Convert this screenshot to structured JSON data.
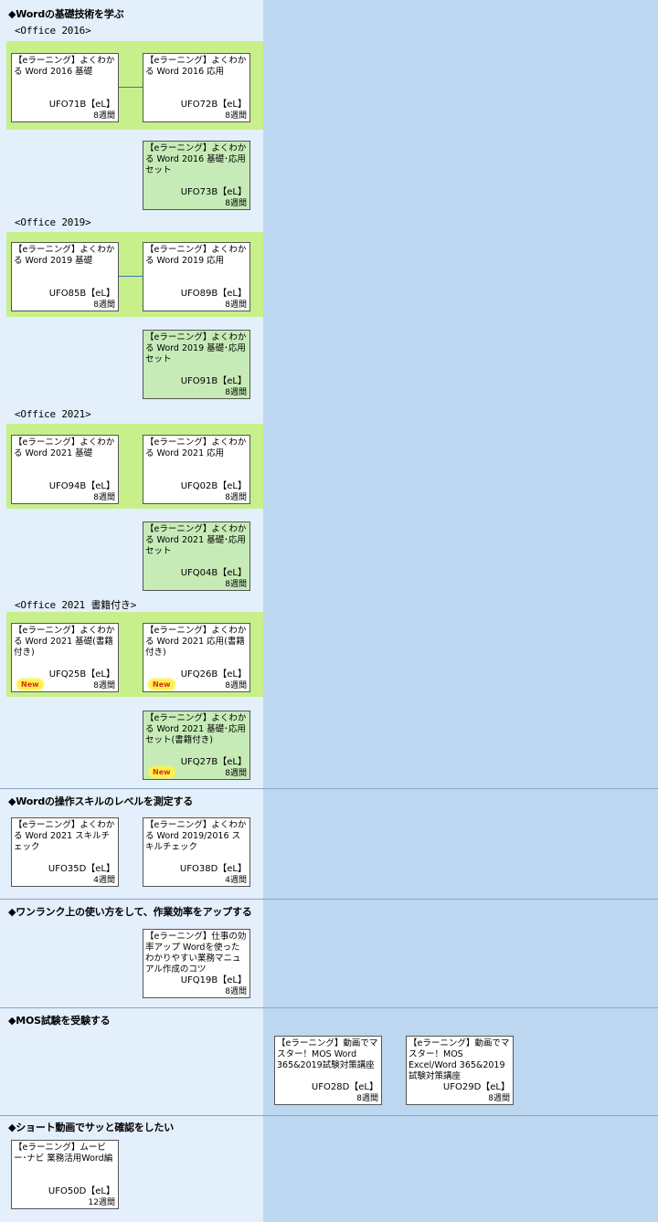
{
  "sections": [
    {
      "title": "◆Wordの基礎技術を学ぶ"
    },
    {
      "title": "◆Wordの操作スキルのレベルを測定する"
    },
    {
      "title": "◆ワンランク上の使い方をして、作業効率をアップする"
    },
    {
      "title": "◆MOS試験を受験する"
    },
    {
      "title": "◆ショート動画でサッと確認をしたい"
    }
  ],
  "subheadings": [
    "<Office 2016>",
    "<Office 2019>",
    "<Office 2021>",
    "<Office 2021 書籍付き>"
  ],
  "new_label": "New",
  "courses": [
    {
      "name": "【eラーニング】よくわかる Word 2016 基礎",
      "code": "UFO71B【eL】",
      "duration": "8週間"
    },
    {
      "name": "【eラーニング】よくわかる Word 2016 応用",
      "code": "UFO72B【eL】",
      "duration": "8週間"
    },
    {
      "name": "【eラーニング】よくわかる Word 2016 基礎･応用セット",
      "code": "UFO73B【eL】",
      "duration": "8週間"
    },
    {
      "name": "【eラーニング】よくわかる Word 2019 基礎",
      "code": "UFO85B【eL】",
      "duration": "8週間"
    },
    {
      "name": "【eラーニング】よくわかる Word 2019 応用",
      "code": "UFO89B【eL】",
      "duration": "8週間"
    },
    {
      "name": "【eラーニング】よくわかる Word 2019 基礎･応用セット",
      "code": "UFO91B【eL】",
      "duration": "8週間"
    },
    {
      "name": "【eラーニング】よくわかる Word 2021 基礎",
      "code": "UFO94B【eL】",
      "duration": "8週間"
    },
    {
      "name": "【eラーニング】よくわかる Word 2021 応用",
      "code": "UFQ02B【eL】",
      "duration": "8週間"
    },
    {
      "name": "【eラーニング】よくわかる Word 2021 基礎･応用セット",
      "code": "UFQ04B【eL】",
      "duration": "8週間"
    },
    {
      "name": "【eラーニング】よくわかる Word 2021 基礎(書籍付き)",
      "code": "UFQ25B【eL】",
      "duration": "8週間"
    },
    {
      "name": "【eラーニング】よくわかる Word 2021 応用(書籍付き)",
      "code": "UFQ26B【eL】",
      "duration": "8週間"
    },
    {
      "name": "【eラーニング】よくわかる Word 2021 基礎･応用セット(書籍付き)",
      "code": "UFQ27B【eL】",
      "duration": "8週間"
    },
    {
      "name": "【eラーニング】よくわかる Word 2021 スキルチェック",
      "code": "UFO35D【eL】",
      "duration": "4週間"
    },
    {
      "name": "【eラーニング】よくわかる Word 2019/2016 スキルチェック",
      "code": "UFO38D【eL】",
      "duration": "4週間"
    },
    {
      "name": "【eラーニング】仕事の効率アップ Wordを使ったわかりやすい業務マニュアル作成のコツ",
      "code": "UFQ19B【eL】",
      "duration": "8週間"
    },
    {
      "name": "【eラーニング】動画でマスター！MOS Word 365&2019試験対策講座",
      "code": "UFO28D【eL】",
      "duration": "8週間"
    },
    {
      "name": "【eラーニング】動画でマスター！MOS Excel/Word 365&2019 試験対策講座",
      "code": "UFO29D【eL】",
      "duration": "8週間"
    },
    {
      "name": "【eラーニング】ムービー･ナビ 業務活用Word編",
      "code": "UFO50D【eL】",
      "duration": "12週間"
    }
  ]
}
